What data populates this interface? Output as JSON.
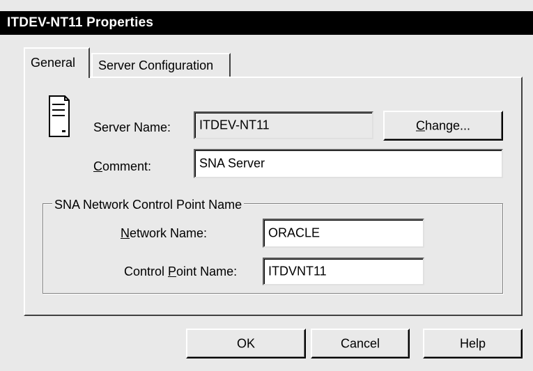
{
  "window": {
    "title": "ITDEV-NT11 Properties"
  },
  "tabs": [
    {
      "label": "General",
      "selected": true
    },
    {
      "label": "Server Configuration",
      "selected": false
    }
  ],
  "general": {
    "server_name": {
      "label": "Server Name:",
      "value": "ITDEV-NT11"
    },
    "change_button": "Change...",
    "comment": {
      "label": "Comment:",
      "value": "SNA Server"
    },
    "group": {
      "title": "SNA Network Control Point Name",
      "network_name": {
        "label": "Network Name:",
        "value": "ORACLE"
      },
      "control_point_name": {
        "label": "Control Point Name:",
        "value": "ITDVNT11"
      }
    }
  },
  "buttons": {
    "ok": "OK",
    "cancel": "Cancel",
    "help": "Help"
  },
  "icons": {
    "server": "server-tower-icon"
  },
  "colors": {
    "titlebar": "#000000",
    "face": "#e9e9e9",
    "field": "#ffffff"
  }
}
